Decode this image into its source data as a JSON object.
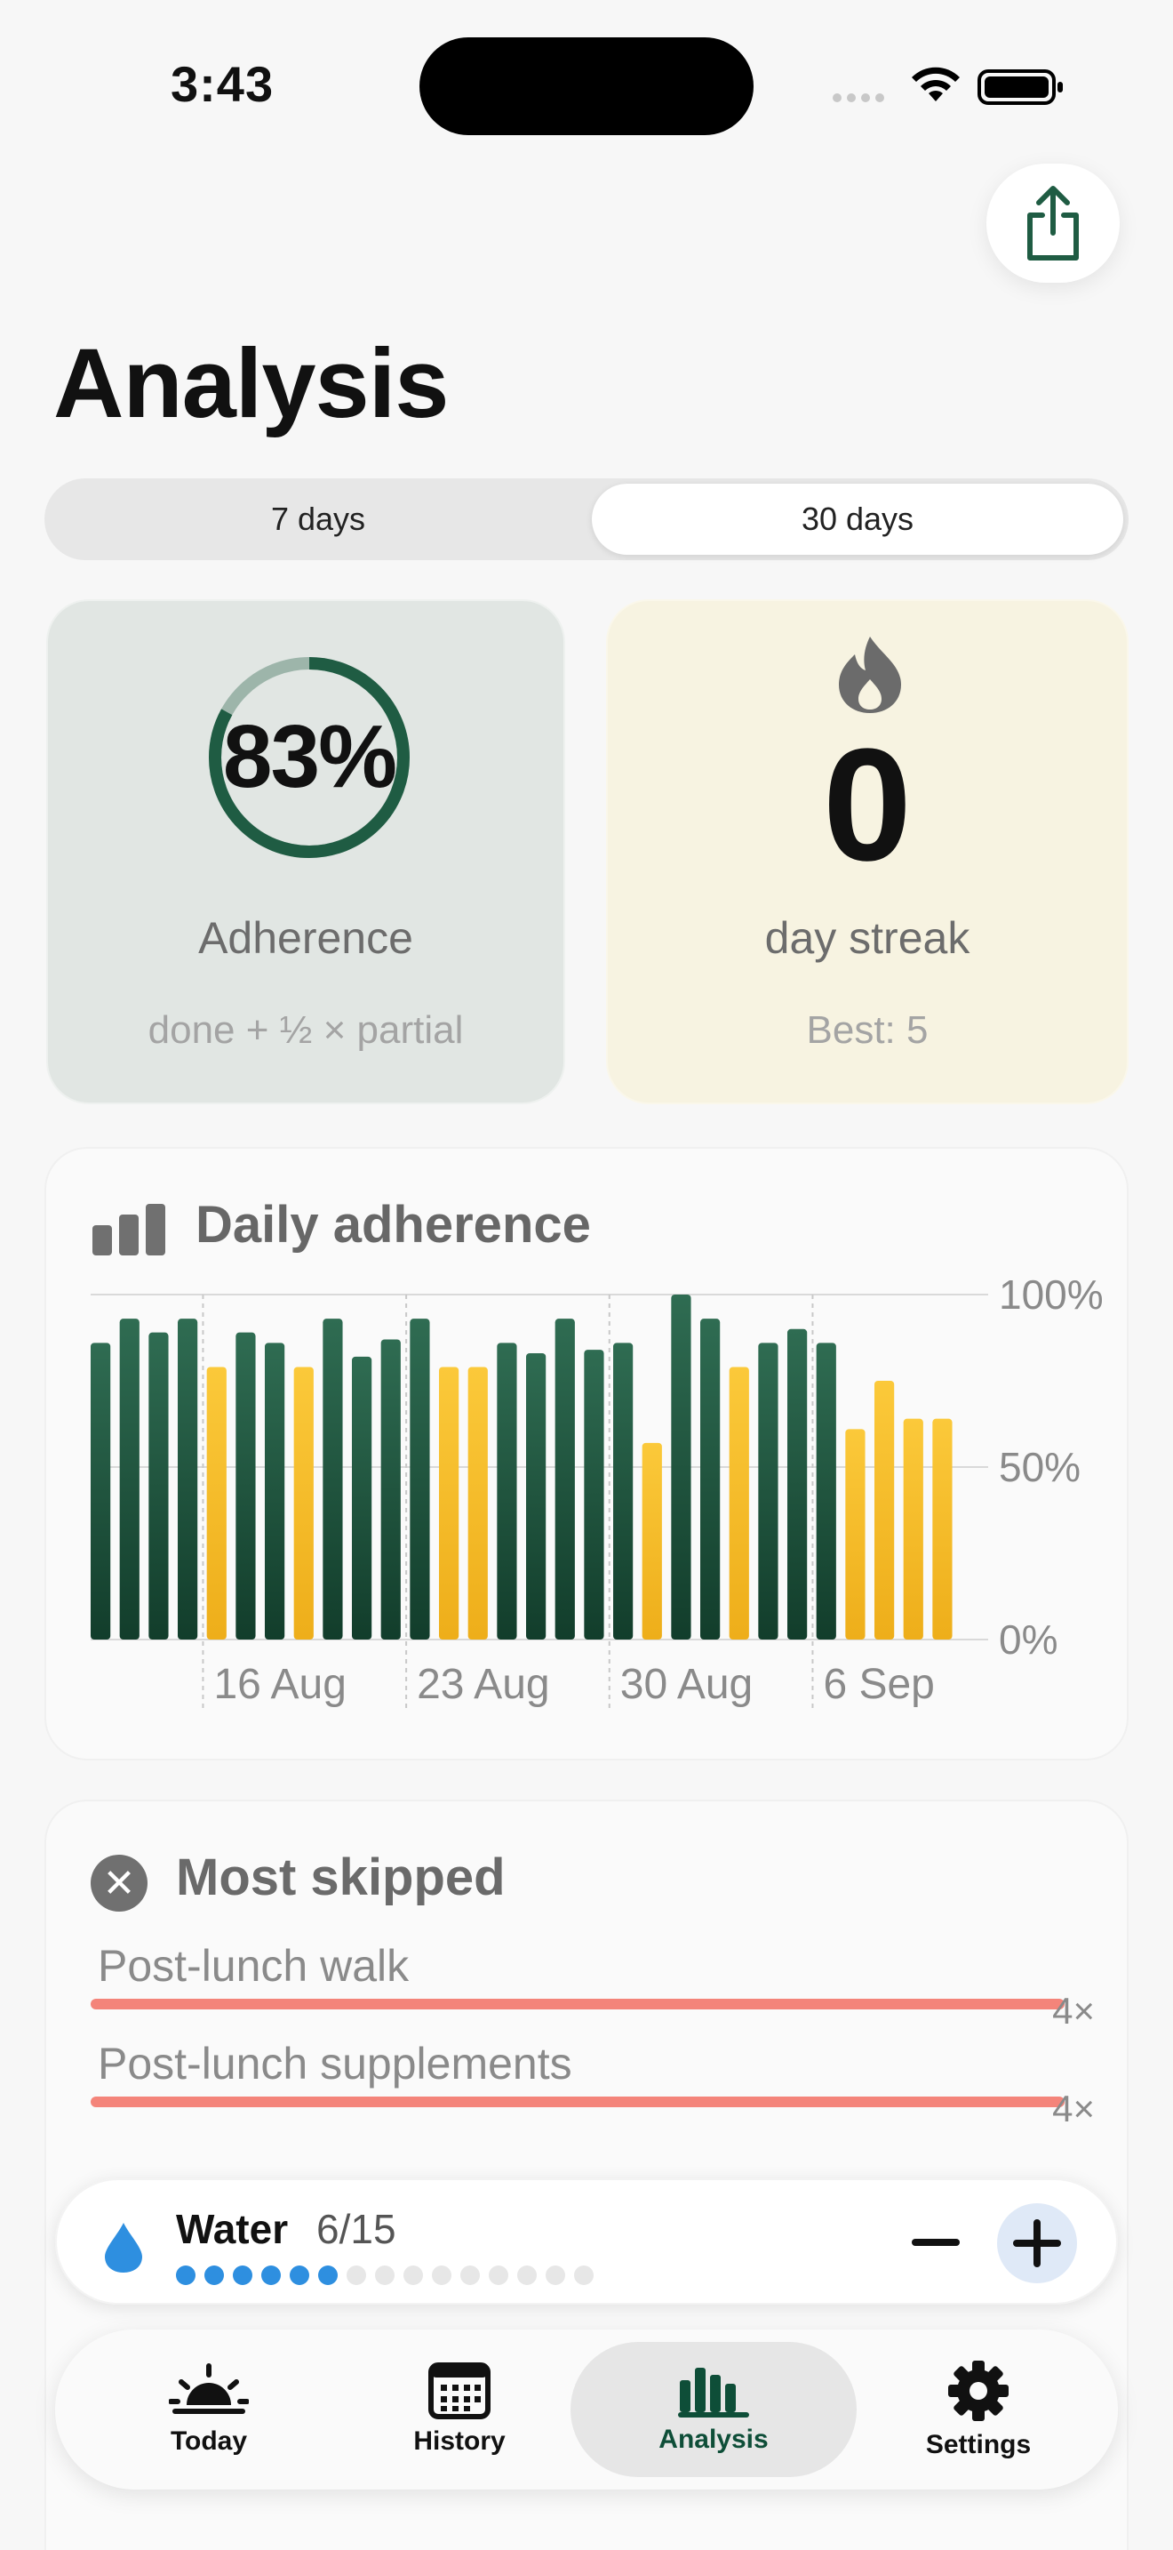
{
  "status_bar": {
    "time": "3:43"
  },
  "header": {
    "title": "Analysis"
  },
  "range_selector": {
    "options": [
      "7 days",
      "30 days"
    ],
    "selected": "30 days"
  },
  "adherence_card": {
    "value": "83%",
    "value_fraction": 0.83,
    "label": "Adherence",
    "subtitle": "done + ½ × partial"
  },
  "streak_card": {
    "value": "0",
    "label": "day streak",
    "subtitle": "Best: 5"
  },
  "chart_card": {
    "title": "Daily adherence"
  },
  "chart_data": {
    "type": "bar",
    "title": "Daily adherence",
    "ylim": [
      0,
      100
    ],
    "y_ticks": [
      "100%",
      "50%",
      "0%"
    ],
    "x_ticks": [
      "16 Aug",
      "23 Aug",
      "30 Aug",
      "6 Sep"
    ],
    "grid": true,
    "series": [
      {
        "values": [
          86,
          93,
          89,
          93,
          79,
          89,
          86,
          79,
          93,
          82,
          87,
          93,
          79,
          79,
          86,
          83,
          93,
          84,
          86,
          57,
          100,
          93,
          79,
          86,
          90,
          86,
          61,
          75,
          64,
          64
        ],
        "status": [
          "complete",
          "complete",
          "complete",
          "complete",
          "partial",
          "complete",
          "complete",
          "partial",
          "complete",
          "complete",
          "complete",
          "complete",
          "partial",
          "partial",
          "complete",
          "complete",
          "complete",
          "complete",
          "complete",
          "partial",
          "complete",
          "complete",
          "partial",
          "complete",
          "complete",
          "complete",
          "partial",
          "partial",
          "partial",
          "partial"
        ]
      }
    ],
    "colors": {
      "complete": "#1f5c43",
      "partial": "#f4bd2a"
    }
  },
  "most_skipped": {
    "title": "Most skipped",
    "items": [
      {
        "label": "Post-lunch walk",
        "count": "4×",
        "value": 4
      },
      {
        "label": "Post-lunch supplements",
        "count": "4×",
        "value": 4
      }
    ]
  },
  "water": {
    "label": "Water",
    "count": "6/15",
    "done": 6,
    "total": 15
  },
  "tabs": [
    {
      "label": "Today",
      "icon": "sunrise-icon"
    },
    {
      "label": "History",
      "icon": "calendar-icon"
    },
    {
      "label": "Analysis",
      "icon": "bar-chart-icon",
      "active": true
    },
    {
      "label": "Settings",
      "icon": "gear-icon"
    }
  ],
  "colors": {
    "accent": "#1f5c43",
    "partial": "#f4bd2a",
    "skip": "#f4847a",
    "water": "#2e8fe0"
  }
}
